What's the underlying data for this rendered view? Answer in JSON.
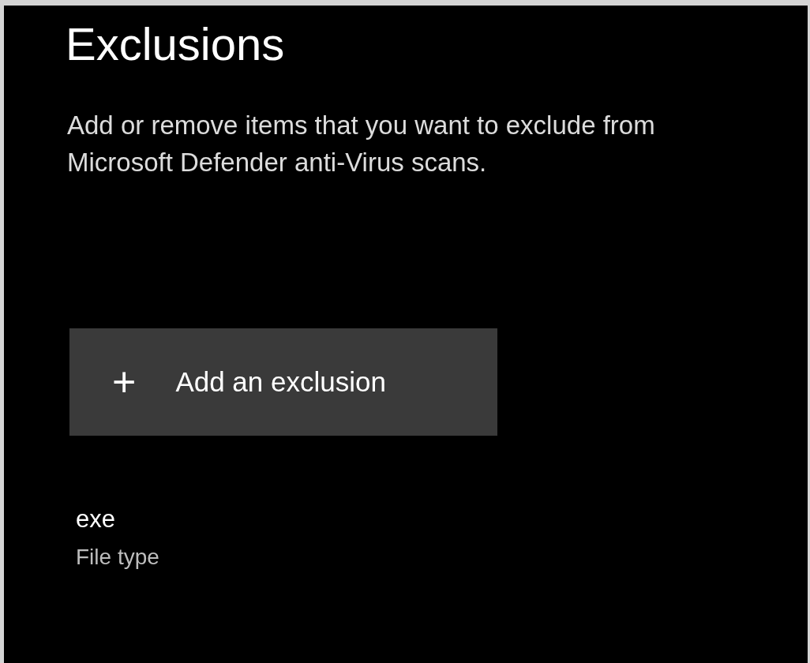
{
  "page": {
    "title": "Exclusions",
    "description": "Add or remove items that you want to exclude from Microsoft Defender anti-Virus scans."
  },
  "add_button": {
    "icon": "+",
    "label": "Add an exclusion"
  },
  "exclusions": [
    {
      "name": "exe",
      "type": "File type"
    }
  ]
}
